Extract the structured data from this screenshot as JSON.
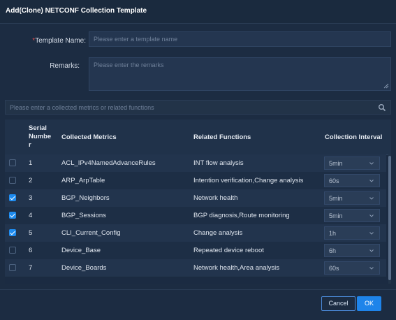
{
  "dialog": {
    "title": "Add(Clone) NETCONF Collection Template",
    "template_name_label": "Template Name:",
    "template_name_placeholder": "Please enter a template name",
    "remarks_label": "Remarks:",
    "remarks_placeholder": "Please enter the remarks",
    "search_placeholder": "Please enter a collected metrics or related functions",
    "colors": {
      "accent": "#1e84ea",
      "required": "#e34b4b",
      "background": "#1c2c42"
    }
  },
  "table": {
    "headers": {
      "serial_line1": "Serial",
      "serial_line2": "Numbe",
      "serial_line3": "r",
      "metrics": "Collected Metrics",
      "functions": "Related Functions",
      "interval": "Collection Interval"
    },
    "rows": [
      {
        "checked": false,
        "serial": "1",
        "metric": "ACL_IPv4NamedAdvanceRules",
        "functions": "INT flow analysis",
        "interval": "5min"
      },
      {
        "checked": false,
        "serial": "2",
        "metric": "ARP_ArpTable",
        "functions": "Intention verification,Change analysis",
        "interval": "60s"
      },
      {
        "checked": true,
        "serial": "3",
        "metric": "BGP_Neighbors",
        "functions": "Network health",
        "interval": "5min"
      },
      {
        "checked": true,
        "serial": "4",
        "metric": "BGP_Sessions",
        "functions": "BGP diagnosis,Route monitoring",
        "interval": "5min"
      },
      {
        "checked": true,
        "serial": "5",
        "metric": "CLI_Current_Config",
        "functions": "Change analysis",
        "interval": "1h"
      },
      {
        "checked": false,
        "serial": "6",
        "metric": "Device_Base",
        "functions": "Repeated device reboot",
        "interval": "6h"
      },
      {
        "checked": false,
        "serial": "7",
        "metric": "Device_Boards",
        "functions": "Network health,Area analysis",
        "interval": "60s"
      }
    ]
  },
  "footer": {
    "cancel_label": "Cancel",
    "ok_label": "OK"
  }
}
